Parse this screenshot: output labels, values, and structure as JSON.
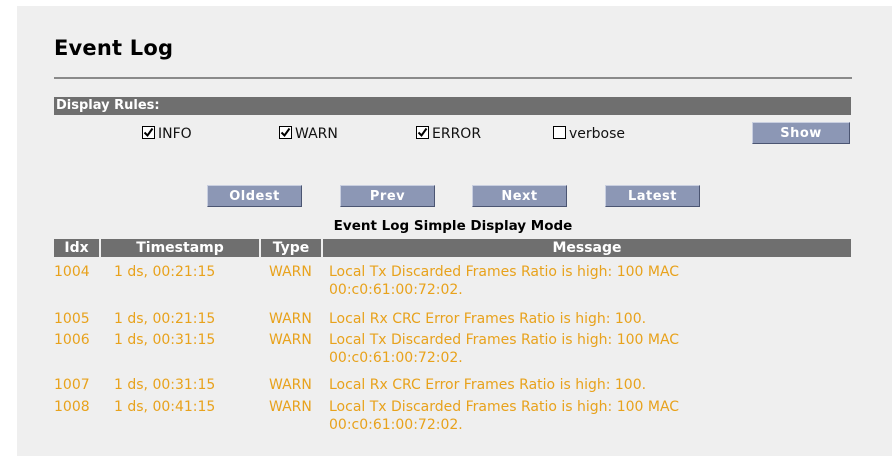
{
  "page_title": "Event Log",
  "display_rules": {
    "label": "Display Rules:",
    "checkboxes": [
      {
        "label": "INFO",
        "checked": true
      },
      {
        "label": "WARN",
        "checked": true
      },
      {
        "label": "ERROR",
        "checked": true
      },
      {
        "label": "verbose",
        "checked": false
      }
    ],
    "show_button": "Show"
  },
  "nav": {
    "oldest": "Oldest",
    "prev": "Prev",
    "next": "Next",
    "latest": "Latest"
  },
  "mode_title": "Event Log Simple Display Mode",
  "table": {
    "columns": [
      "Idx",
      "Timestamp",
      "Type",
      "Message"
    ],
    "rows": [
      {
        "idx": "1004",
        "timestamp": "1 ds, 00:21:15",
        "type": "WARN",
        "message_line1": "Local Tx Discarded Frames Ratio is high: 100 MAC",
        "message_line2": "00:c0:61:00:72:02."
      },
      {
        "idx": "1005",
        "timestamp": "1 ds, 00:21:15",
        "type": "WARN",
        "message_line1": "Local Rx CRC Error Frames Ratio is high: 100.",
        "message_line2": ""
      },
      {
        "idx": "1006",
        "timestamp": "1 ds, 00:31:15",
        "type": "WARN",
        "message_line1": "Local Tx Discarded Frames Ratio is high: 100 MAC",
        "message_line2": "00:c0:61:00:72:02."
      },
      {
        "idx": "1007",
        "timestamp": "1 ds, 00:31:15",
        "type": "WARN",
        "message_line1": "Local Rx CRC Error Frames Ratio is high: 100.",
        "message_line2": ""
      },
      {
        "idx": "1008",
        "timestamp": "1 ds, 00:41:15",
        "type": "WARN",
        "message_line1": "Local Tx Discarded Frames Ratio is high: 100 MAC",
        "message_line2": "00:c0:61:00:72:02."
      }
    ]
  },
  "colors": {
    "row_text": "#e8a21c",
    "header_bar": "#6f6f6f",
    "button": "#8c97b5"
  }
}
